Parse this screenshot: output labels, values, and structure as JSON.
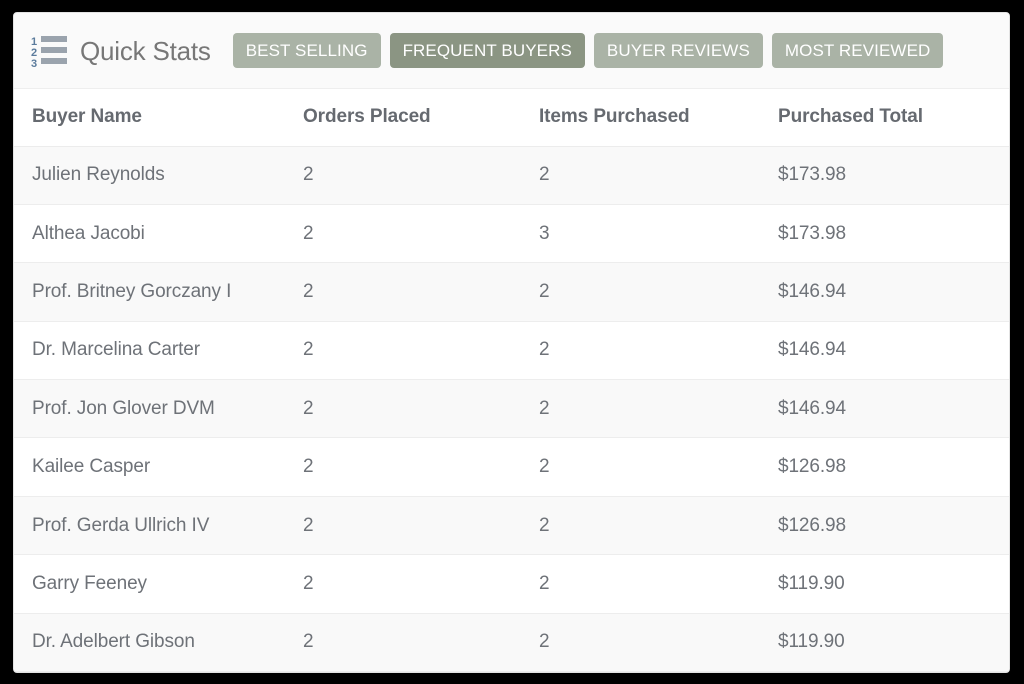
{
  "panel": {
    "icon": "ordered-list-icon",
    "title": "Quick Stats"
  },
  "tabs": [
    {
      "label": "BEST SELLING",
      "active": false
    },
    {
      "label": "FREQUENT BUYERS",
      "active": true
    },
    {
      "label": "BUYER REVIEWS",
      "active": false
    },
    {
      "label": "MOST REVIEWED",
      "active": false
    }
  ],
  "table": {
    "columns": [
      "Buyer Name",
      "Orders Placed",
      "Items Purchased",
      "Purchased Total"
    ],
    "rows": [
      {
        "buyer_name": "Julien Reynolds",
        "orders_placed": "2",
        "items_purchased": "2",
        "purchased_total": "$173.98"
      },
      {
        "buyer_name": "Althea Jacobi",
        "orders_placed": "2",
        "items_purchased": "3",
        "purchased_total": "$173.98"
      },
      {
        "buyer_name": "Prof. Britney Gorczany I",
        "orders_placed": "2",
        "items_purchased": "2",
        "purchased_total": "$146.94"
      },
      {
        "buyer_name": "Dr. Marcelina Carter",
        "orders_placed": "2",
        "items_purchased": "2",
        "purchased_total": "$146.94"
      },
      {
        "buyer_name": "Prof. Jon Glover DVM",
        "orders_placed": "2",
        "items_purchased": "2",
        "purchased_total": "$146.94"
      },
      {
        "buyer_name": "Kailee Casper",
        "orders_placed": "2",
        "items_purchased": "2",
        "purchased_total": "$126.98"
      },
      {
        "buyer_name": "Prof. Gerda Ullrich IV",
        "orders_placed": "2",
        "items_purchased": "2",
        "purchased_total": "$126.98"
      },
      {
        "buyer_name": "Garry Feeney",
        "orders_placed": "2",
        "items_purchased": "2",
        "purchased_total": "$119.90"
      },
      {
        "buyer_name": "Dr. Adelbert Gibson",
        "orders_placed": "2",
        "items_purchased": "2",
        "purchased_total": "$119.90"
      }
    ]
  },
  "colors": {
    "tab_inactive": "#aab3a6",
    "tab_active": "#8b9583",
    "tab_text": "#ffffff",
    "title_text": "#777777",
    "header_text": "#666a70",
    "cell_text": "#6e7278",
    "row_odd_bg": "#f9f9f9",
    "row_even_bg": "#ffffff",
    "card_bg": "#ffffff",
    "page_bg": "#000000",
    "icon_number": "#5b7b9c",
    "icon_bar": "#9aa3ad"
  }
}
